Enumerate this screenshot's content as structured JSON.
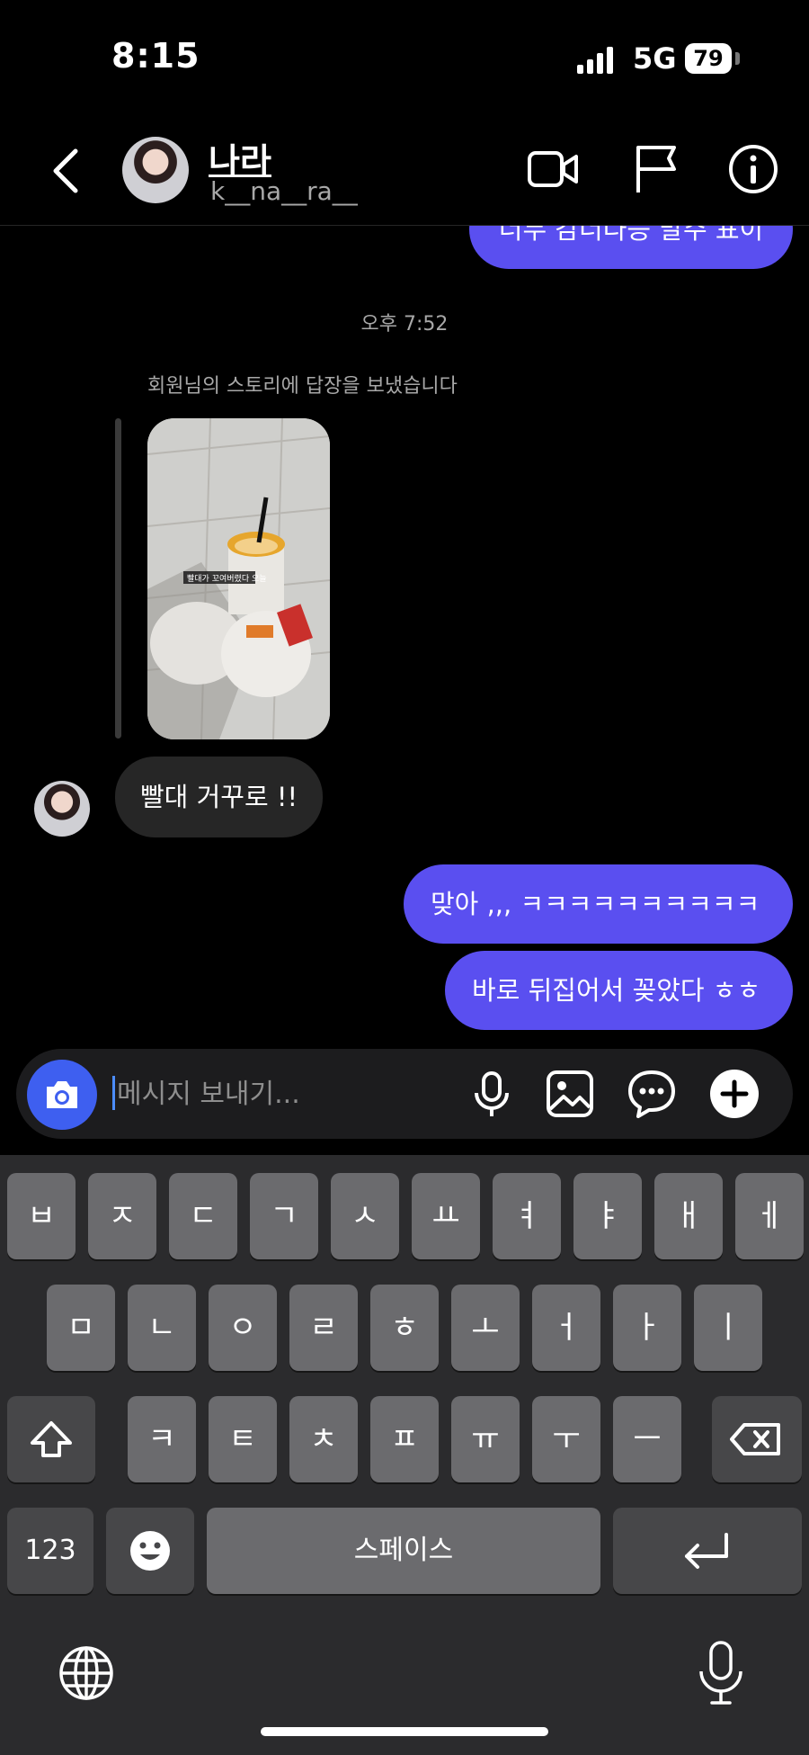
{
  "status_bar": {
    "time": "8:15",
    "network": "5G",
    "battery": "79"
  },
  "header": {
    "name": "나라",
    "username": "k__na__ra__"
  },
  "icons": {
    "back": "chevron-left-icon",
    "video": "video-camera-icon",
    "flag": "flag-icon",
    "info": "info-icon",
    "camera": "camera-icon",
    "mic": "microphone-icon",
    "gallery": "image-icon",
    "sticker": "chat-bubble-dots-icon",
    "plus": "plus-circle-icon",
    "globe": "globe-icon",
    "dictation": "microphone-icon",
    "shift": "shift-icon",
    "delete": "backspace-icon",
    "emoji": "emoji-icon",
    "return": "return-icon"
  },
  "chat": {
    "partial_message": "너무 감너다등 말주 표이",
    "timestamp": "오후 7:52",
    "story_reply_note": "회원님의 스토리에 답장을 보냈습니다",
    "story_caption": "빨대가 꼬여버렸다 오늘",
    "incoming_message": "빨대 거꾸로 !!",
    "outgoing_messages": [
      "맞아 ,,, ㅋㅋㅋㅋㅋㅋㅋㅋㅋㅋ",
      "바로 뒤집어서 꽂았다 ㅎㅎ"
    ]
  },
  "composer": {
    "placeholder": "메시지 보내기..."
  },
  "keyboard": {
    "row1": [
      "ㅂ",
      "ㅈ",
      "ㄷ",
      "ㄱ",
      "ㅅ",
      "ㅛ",
      "ㅕ",
      "ㅑ",
      "ㅐ",
      "ㅔ"
    ],
    "row2": [
      "ㅁ",
      "ㄴ",
      "ㅇ",
      "ㄹ",
      "ㅎ",
      "ㅗ",
      "ㅓ",
      "ㅏ",
      "ㅣ"
    ],
    "row3": [
      "ㅋ",
      "ㅌ",
      "ㅊ",
      "ㅍ",
      "ㅠ",
      "ㅜ",
      "ㅡ"
    ],
    "numbers_key": "123",
    "space_key": "스페이스"
  },
  "colors": {
    "outgoing_bubble": "#5a4ff0",
    "incoming_bubble": "#262626",
    "camera_button": "#3e5ff0",
    "background": "#000000"
  }
}
